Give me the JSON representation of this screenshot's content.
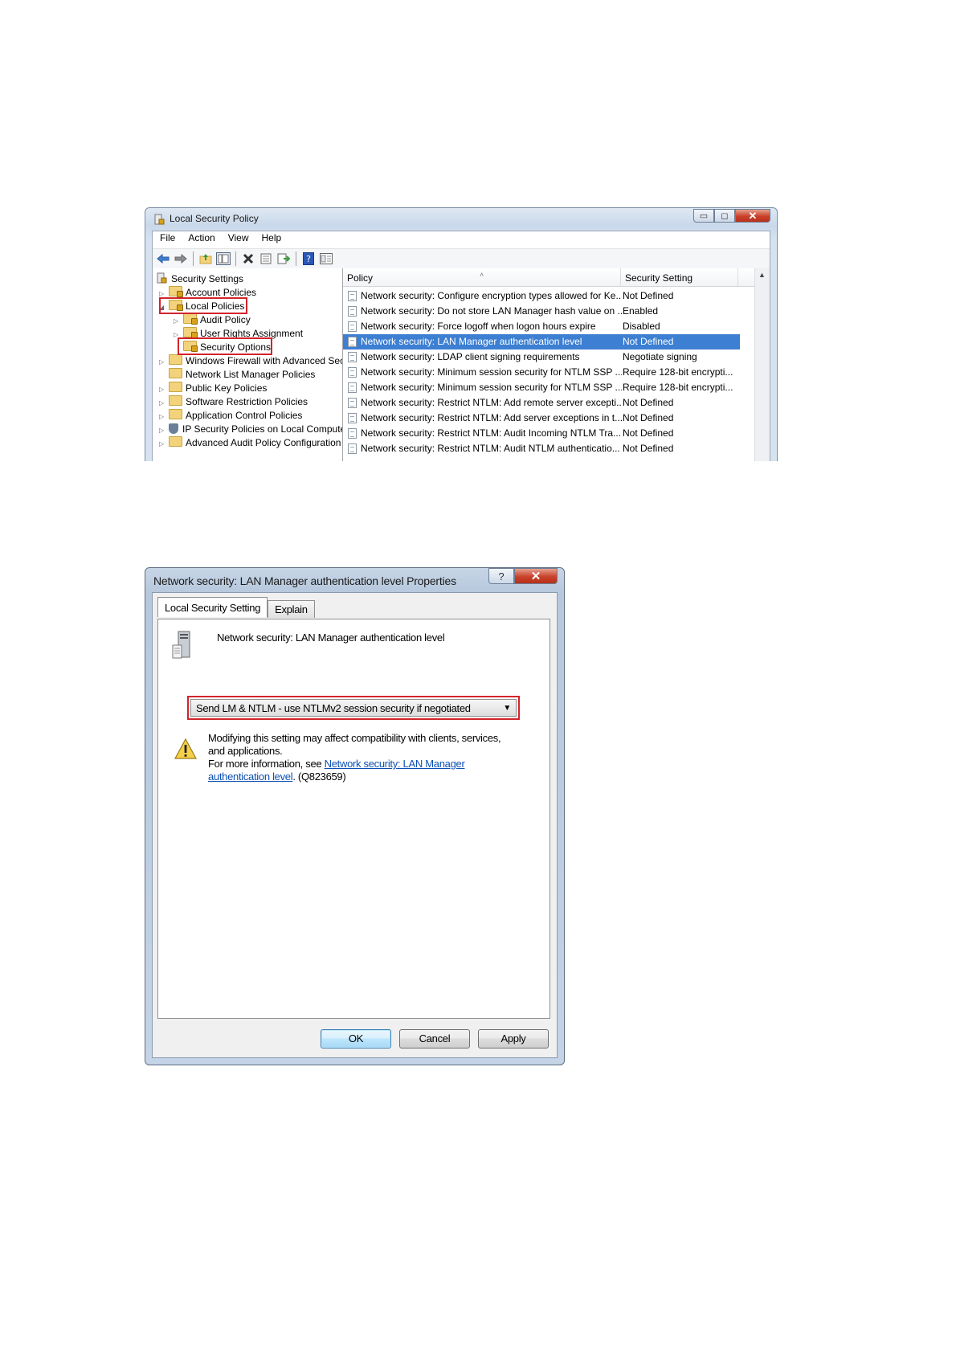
{
  "main_window": {
    "title": "Local Security Policy",
    "caption_buttons": {
      "minimize": "▭",
      "maximize": "◻",
      "close": "✕"
    },
    "menu": [
      "File",
      "Action",
      "View",
      "Help"
    ],
    "toolbar_icons": [
      "back-icon",
      "forward-icon",
      "up-folder-icon",
      "show-hide-tree-icon",
      "delete-icon",
      "properties-icon",
      "export-list-icon",
      "help-icon",
      "view-icon"
    ],
    "tree": {
      "root": "Security Settings",
      "items": [
        {
          "label": "Account Policies",
          "level": 1,
          "arrow": "▷"
        },
        {
          "label": "Local Policies",
          "level": 1,
          "arrow": "◢"
        },
        {
          "label": "Audit Policy",
          "level": 2,
          "arrow": "▷"
        },
        {
          "label": "User Rights Assignment",
          "level": 2,
          "arrow": "▷"
        },
        {
          "label": "Security Options",
          "level": 2,
          "arrow": ""
        },
        {
          "label": "Windows Firewall with Advanced Secu",
          "level": 1,
          "arrow": "▷"
        },
        {
          "label": "Network List Manager Policies",
          "level": 1,
          "arrow": ""
        },
        {
          "label": "Public Key Policies",
          "level": 1,
          "arrow": "▷"
        },
        {
          "label": "Software Restriction Policies",
          "level": 1,
          "arrow": "▷"
        },
        {
          "label": "Application Control Policies",
          "level": 1,
          "arrow": "▷"
        },
        {
          "label": "IP Security Policies on Local Compute",
          "level": 1,
          "arrow": "▷"
        },
        {
          "label": "Advanced Audit Policy Configuration",
          "level": 1,
          "arrow": "▷"
        }
      ]
    },
    "list": {
      "columns": {
        "policy": "Policy",
        "setting": "Security Setting"
      },
      "rows": [
        {
          "policy": "Network security: Configure encryption types allowed for Ke...",
          "setting": "Not Defined"
        },
        {
          "policy": "Network security: Do not store LAN Manager hash value on ...",
          "setting": "Enabled"
        },
        {
          "policy": "Network security: Force logoff when logon hours expire",
          "setting": "Disabled"
        },
        {
          "policy": "Network security: LAN Manager authentication level",
          "setting": "Not Defined",
          "selected": true
        },
        {
          "policy": "Network security: LDAP client signing requirements",
          "setting": "Negotiate signing"
        },
        {
          "policy": "Network security: Minimum session security for NTLM SSP ...",
          "setting": "Require 128-bit encrypti..."
        },
        {
          "policy": "Network security: Minimum session security for NTLM SSP ...",
          "setting": "Require 128-bit encrypti..."
        },
        {
          "policy": "Network security: Restrict NTLM: Add remote server excepti...",
          "setting": "Not Defined"
        },
        {
          "policy": "Network security: Restrict NTLM: Add server exceptions in t...",
          "setting": "Not Defined"
        },
        {
          "policy": "Network security: Restrict NTLM: Audit Incoming NTLM Tra...",
          "setting": "Not Defined"
        },
        {
          "policy": "Network security: Restrict NTLM: Audit NTLM authenticatio...",
          "setting": "Not Defined"
        }
      ]
    }
  },
  "dialog": {
    "title": "Network security: LAN Manager authentication level Properties",
    "caption_buttons": {
      "help": "?",
      "close": "✕"
    },
    "tabs": [
      "Local Security Setting",
      "Explain"
    ],
    "policy_name": "Network security: LAN Manager authentication level",
    "selected_value": "Send LM & NTLM - use NTLMv2 session security if negotiated",
    "warning_line1": "Modifying this setting may affect compatibility with clients, services, and applications.",
    "warning_prefix": "For more information, see",
    "warning_link": "Network security: LAN Manager authentication level",
    "warning_suffix": ". (Q823659)",
    "buttons": {
      "ok": "OK",
      "cancel": "Cancel",
      "apply": "Apply"
    }
  },
  "colors": {
    "highlight": "#3d7fd2",
    "annotation_red": "#d2232a",
    "link": "#0c4fb3"
  }
}
